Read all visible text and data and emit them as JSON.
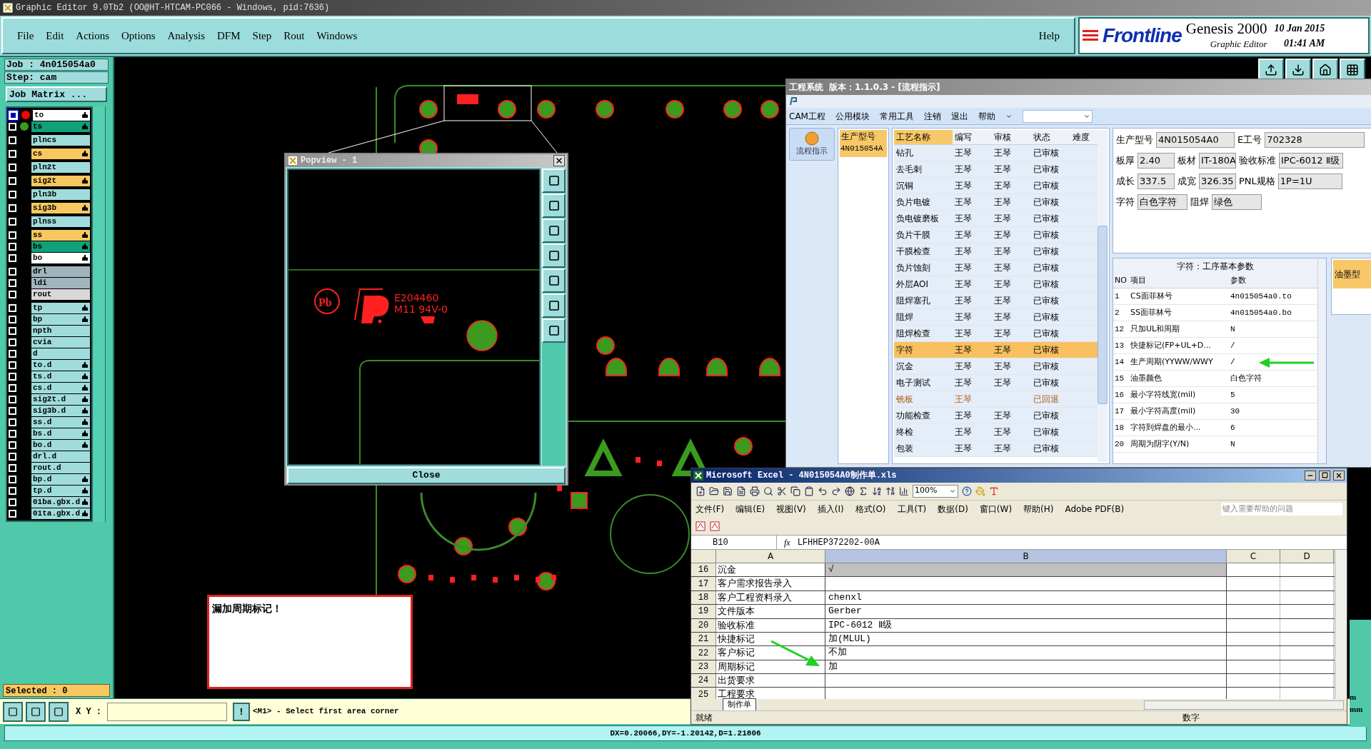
{
  "title_bar": {
    "title": "Graphic Editor 9.0Tb2 (OO@HT-HTCAM-PC066 - Windows, pid:7636)"
  },
  "menu": [
    "File",
    "Edit",
    "Actions",
    "Options",
    "Analysis",
    "DFM",
    "Step",
    "Rout",
    "Windows"
  ],
  "help": "Help",
  "brand": {
    "name": "Frontline",
    "product": "Genesis 2000",
    "subtitle": "Graphic Editor",
    "date": "10 Jan 2015",
    "time": "01:41 AM"
  },
  "job_panel": {
    "job": "Job : 4n015054a0",
    "step": "Step: cam",
    "matrix_button": "Job Matrix ..."
  },
  "layer_groups": [
    {
      "layers": [
        {
          "name": "to",
          "color": "#ffffff",
          "selected": true,
          "dot": {
            "color": "#ff0000"
          },
          "affected": true
        },
        {
          "name": "ts",
          "color": "#10a07a",
          "selected": false,
          "dot": {
            "color": "#3c9a1e"
          },
          "affected": true
        }
      ]
    },
    {
      "layers": [
        {
          "name": "plncs",
          "color": "#a0dcdc",
          "selected": false,
          "affected": false
        }
      ]
    },
    {
      "layers": [
        {
          "name": "cs",
          "color": "#f8c860",
          "selected": false,
          "affected": true
        }
      ]
    },
    {
      "layers": [
        {
          "name": "pln2t",
          "color": "#a0dcdc",
          "selected": false,
          "affected": false
        }
      ]
    },
    {
      "layers": [
        {
          "name": "sig2t",
          "color": "#f8c860",
          "selected": false,
          "affected": true
        }
      ]
    },
    {
      "layers": [
        {
          "name": "pln3b",
          "color": "#a0dcdc",
          "selected": false,
          "affected": false
        }
      ]
    },
    {
      "layers": [
        {
          "name": "sig3b",
          "color": "#f8c860",
          "selected": false,
          "affected": true
        }
      ]
    },
    {
      "layers": [
        {
          "name": "plnss",
          "color": "#a0dcdc",
          "selected": false,
          "affected": false
        }
      ]
    },
    {
      "layers": [
        {
          "name": "ss",
          "color": "#f8c860",
          "selected": false,
          "affected": true
        },
        {
          "name": "bs",
          "color": "#10a07a",
          "selected": false,
          "affected": true
        },
        {
          "name": "bo",
          "color": "#ffffff",
          "selected": false,
          "affected": true
        }
      ]
    },
    {
      "layers": [
        {
          "name": "drl",
          "color": "#a0b4bc",
          "selected": false,
          "affected": false
        },
        {
          "name": "ldi",
          "color": "#a0b4bc",
          "selected": false,
          "affected": false
        },
        {
          "name": "rout",
          "color": "#d8d8d8",
          "selected": false,
          "affected": false
        }
      ]
    },
    {
      "layers": [
        {
          "name": "tp",
          "color": "#a0dcdc",
          "selected": false,
          "affected": true
        },
        {
          "name": "bp",
          "color": "#a0dcdc",
          "selected": false,
          "affected": true
        },
        {
          "name": "npth",
          "color": "#a0dcdc",
          "selected": false,
          "affected": false
        },
        {
          "name": "cvia",
          "color": "#a0dcdc",
          "selected": false,
          "affected": false
        },
        {
          "name": "d",
          "color": "#a0dcdc",
          "selected": false,
          "affected": false
        },
        {
          "name": "to.d",
          "color": "#a0dcdc",
          "selected": false,
          "affected": true
        },
        {
          "name": "ts.d",
          "color": "#a0dcdc",
          "selected": false,
          "affected": true
        },
        {
          "name": "cs.d",
          "color": "#a0dcdc",
          "selected": false,
          "affected": true
        },
        {
          "name": "sig2t.d",
          "color": "#a0dcdc",
          "selected": false,
          "affected": true
        },
        {
          "name": "sig3b.d",
          "color": "#a0dcdc",
          "selected": false,
          "affected": true
        },
        {
          "name": "ss.d",
          "color": "#a0dcdc",
          "selected": false,
          "affected": true
        },
        {
          "name": "bs.d",
          "color": "#a0dcdc",
          "selected": false,
          "affected": true
        },
        {
          "name": "bo.d",
          "color": "#a0dcdc",
          "selected": false,
          "affected": true
        },
        {
          "name": "drl.d",
          "color": "#a0dcdc",
          "selected": false,
          "affected": false
        },
        {
          "name": "rout.d",
          "color": "#a0dcdc",
          "selected": false,
          "affected": false
        },
        {
          "name": "bp.d",
          "color": "#a0dcdc",
          "selected": false,
          "affected": true
        },
        {
          "name": "tp.d",
          "color": "#a0dcdc",
          "selected": false,
          "affected": true
        },
        {
          "name": "01ba.gbx.d",
          "color": "#a0dcdc",
          "selected": false,
          "affected": true
        },
        {
          "name": "01ta.gbx.d",
          "color": "#a0dcdc",
          "selected": false,
          "affected": true
        }
      ]
    }
  ],
  "selected_count": "Selected : 0",
  "popview": {
    "title": "Popview - 1",
    "close": "Close",
    "pb": "Pb",
    "ul_file": "E204460",
    "rating": "M11 94V-0"
  },
  "message": "漏加周期标记！",
  "coord_bar": {
    "label": "X Y :",
    "warn": "!",
    "prompt": "<M1> - Select first area corner"
  },
  "status_bar": "DX=0.20066,DY=-1.20142,D=1.21806",
  "side_units": [
    "m",
    "mm"
  ],
  "eng": {
    "title": "工程系统",
    "version": "版本：1.1.0.3 - [流程指示]",
    "menu": [
      "CAM工程",
      "公用模块",
      "常用工具",
      "注销",
      "退出",
      "帮助"
    ],
    "side_button": "流程指示",
    "model_list": {
      "header": "生产型号",
      "items": [
        {
          "label": "4N015054A",
          "selected": true
        }
      ]
    },
    "process_columns": [
      "工艺名称",
      "编写",
      "审核",
      "状态",
      "难度"
    ],
    "process_rows": [
      {
        "name": "钻孔",
        "author": "王琴",
        "reviewer": "王琴",
        "status": "已审核",
        "selected": false,
        "returned": false
      },
      {
        "name": "去毛刺",
        "author": "王琴",
        "reviewer": "王琴",
        "status": "已审核",
        "selected": false,
        "returned": false
      },
      {
        "name": "沉铜",
        "author": "王琴",
        "reviewer": "王琴",
        "status": "已审核",
        "selected": false,
        "returned": false
      },
      {
        "name": "负片电镀",
        "author": "王琴",
        "reviewer": "王琴",
        "status": "已审核",
        "selected": false,
        "returned": false
      },
      {
        "name": "负电镀磨板",
        "author": "王琴",
        "reviewer": "王琴",
        "status": "已审核",
        "selected": false,
        "returned": false
      },
      {
        "name": "负片干膜",
        "author": "王琴",
        "reviewer": "王琴",
        "status": "已审核",
        "selected": false,
        "returned": false
      },
      {
        "name": "干膜检查",
        "author": "王琴",
        "reviewer": "王琴",
        "status": "已审核",
        "selected": false,
        "returned": false
      },
      {
        "name": "负片蚀刻",
        "author": "王琴",
        "reviewer": "王琴",
        "status": "已审核",
        "selected": false,
        "returned": false
      },
      {
        "name": "外层AOI",
        "author": "王琴",
        "reviewer": "王琴",
        "status": "已审核",
        "selected": false,
        "returned": false
      },
      {
        "name": "阻焊塞孔",
        "author": "王琴",
        "reviewer": "王琴",
        "status": "已审核",
        "selected": false,
        "returned": false
      },
      {
        "name": "阻焊",
        "author": "王琴",
        "reviewer": "王琴",
        "status": "已审核",
        "selected": false,
        "returned": false
      },
      {
        "name": "阻焊检查",
        "author": "王琴",
        "reviewer": "王琴",
        "status": "已审核",
        "selected": false,
        "returned": false
      },
      {
        "name": "字符",
        "author": "王琴",
        "reviewer": "王琴",
        "status": "已审核",
        "selected": true,
        "returned": false
      },
      {
        "name": "沉金",
        "author": "王琴",
        "reviewer": "王琴",
        "status": "已审核",
        "selected": false,
        "returned": false
      },
      {
        "name": "电子测试",
        "author": "王琴",
        "reviewer": "王琴",
        "status": "已审核",
        "selected": false,
        "returned": false
      },
      {
        "name": "铣板",
        "author": "王琴",
        "status": "已回退",
        "selected": false,
        "returned": true
      },
      {
        "name": "功能检查",
        "author": "王琴",
        "reviewer": "王琴",
        "status": "已审核",
        "selected": false,
        "returned": false
      },
      {
        "name": "终检",
        "author": "王琴",
        "reviewer": "王琴",
        "status": "已审核",
        "selected": false,
        "returned": false
      },
      {
        "name": "包装",
        "author": "王琴",
        "reviewer": "王琴",
        "status": "已审核",
        "selected": false,
        "returned": false
      }
    ],
    "info_rows": [
      [
        {
          "label": "生产型号",
          "value": "4N015054A0"
        },
        {
          "label": "E工号",
          "value": "702328"
        }
      ],
      [
        {
          "label": "板厚",
          "value": "2.40"
        },
        {
          "label": "板材",
          "value": "IT-180A"
        },
        {
          "label": "验收标准",
          "value": "IPC-6012 Ⅱ级"
        }
      ],
      [
        {
          "label": "成长",
          "value": "337.5"
        },
        {
          "label": "成宽",
          "value": "326.35"
        },
        {
          "label": "PNL规格",
          "value": "1P=1U"
        }
      ],
      [
        {
          "label": "字符",
          "value": "白色字符"
        },
        {
          "label": "阻焊",
          "value": "绿色"
        }
      ]
    ],
    "params_title": "字符：工序基本参数",
    "params_columns": [
      "NO",
      "项目",
      "参数"
    ],
    "params_rows": [
      {
        "no": "1",
        "item": "CS面菲林号",
        "value": "4n015054a0.to"
      },
      {
        "no": "2",
        "item": "SS面菲林号",
        "value": "4n015054a0.bo"
      },
      {
        "no": "12",
        "item": "只加UL和周期",
        "value": "N"
      },
      {
        "no": "13",
        "item": "快捷标记(FP+UL+D...",
        "value": "/"
      },
      {
        "no": "14",
        "item": "生产周期(YYWW/WWY",
        "value": "/"
      },
      {
        "no": "15",
        "item": "油墨颜色",
        "value": "白色字符"
      },
      {
        "no": "16",
        "item": "最小字符线宽(mil)",
        "value": "5"
      },
      {
        "no": "17",
        "item": "最小字符高度(mil)",
        "value": "30"
      },
      {
        "no": "18",
        "item": "字符到焊盘的最小...",
        "value": "6"
      },
      {
        "no": "20",
        "item": "周期为阴字(Y/N)",
        "value": "N"
      }
    ],
    "side_tab": "油墨型"
  },
  "excel": {
    "title": "Microsoft Excel - 4N015054A0制作单.xls",
    "zoom": "100%",
    "menu": [
      "文件(F)",
      "编辑(E)",
      "视图(V)",
      "插入(I)",
      "格式(O)",
      "工具(T)",
      "数据(D)",
      "窗口(W)",
      "帮助(H)",
      "Adobe PDF(B)"
    ],
    "help_box": {
      "placeholder": "键入需要帮助的问题"
    },
    "name_box": "B10",
    "fx_label": "fx",
    "formula": "LFHHEP372202-00A",
    "columns": [
      {
        "label": "A",
        "selected": false
      },
      {
        "label": "B",
        "selected": true
      },
      {
        "label": "C",
        "selected": false
      },
      {
        "label": "D",
        "selected": false
      }
    ],
    "rows": [
      {
        "num": "16",
        "a": "沉金",
        "b": "√",
        "highlighted": true
      },
      {
        "num": "17",
        "a": "客户需求报告录入",
        "highlighted": false
      },
      {
        "num": "18",
        "a": "客户工程资料录入",
        "b": "chenxl",
        "highlighted": false
      },
      {
        "num": "19",
        "a": "文件版本",
        "b": "Gerber",
        "highlighted": false
      },
      {
        "num": "20",
        "a": "验收标准",
        "b": "IPC-6012 Ⅱ级",
        "highlighted": false
      },
      {
        "num": "21",
        "a": "快捷标记",
        "b": "加(MLUL)",
        "highlighted": false
      },
      {
        "num": "22",
        "a": "客户标记",
        "b": "不加",
        "highlighted": false
      },
      {
        "num": "23",
        "a": "周期标记",
        "b": "加",
        "highlighted": false
      },
      {
        "num": "24",
        "a": "出货要求",
        "highlighted": false
      },
      {
        "num": "25",
        "a": "工程要求",
        "highlighted": false
      }
    ],
    "sheet_tab": "制作单",
    "status": "就绪",
    "mode": "数字"
  }
}
